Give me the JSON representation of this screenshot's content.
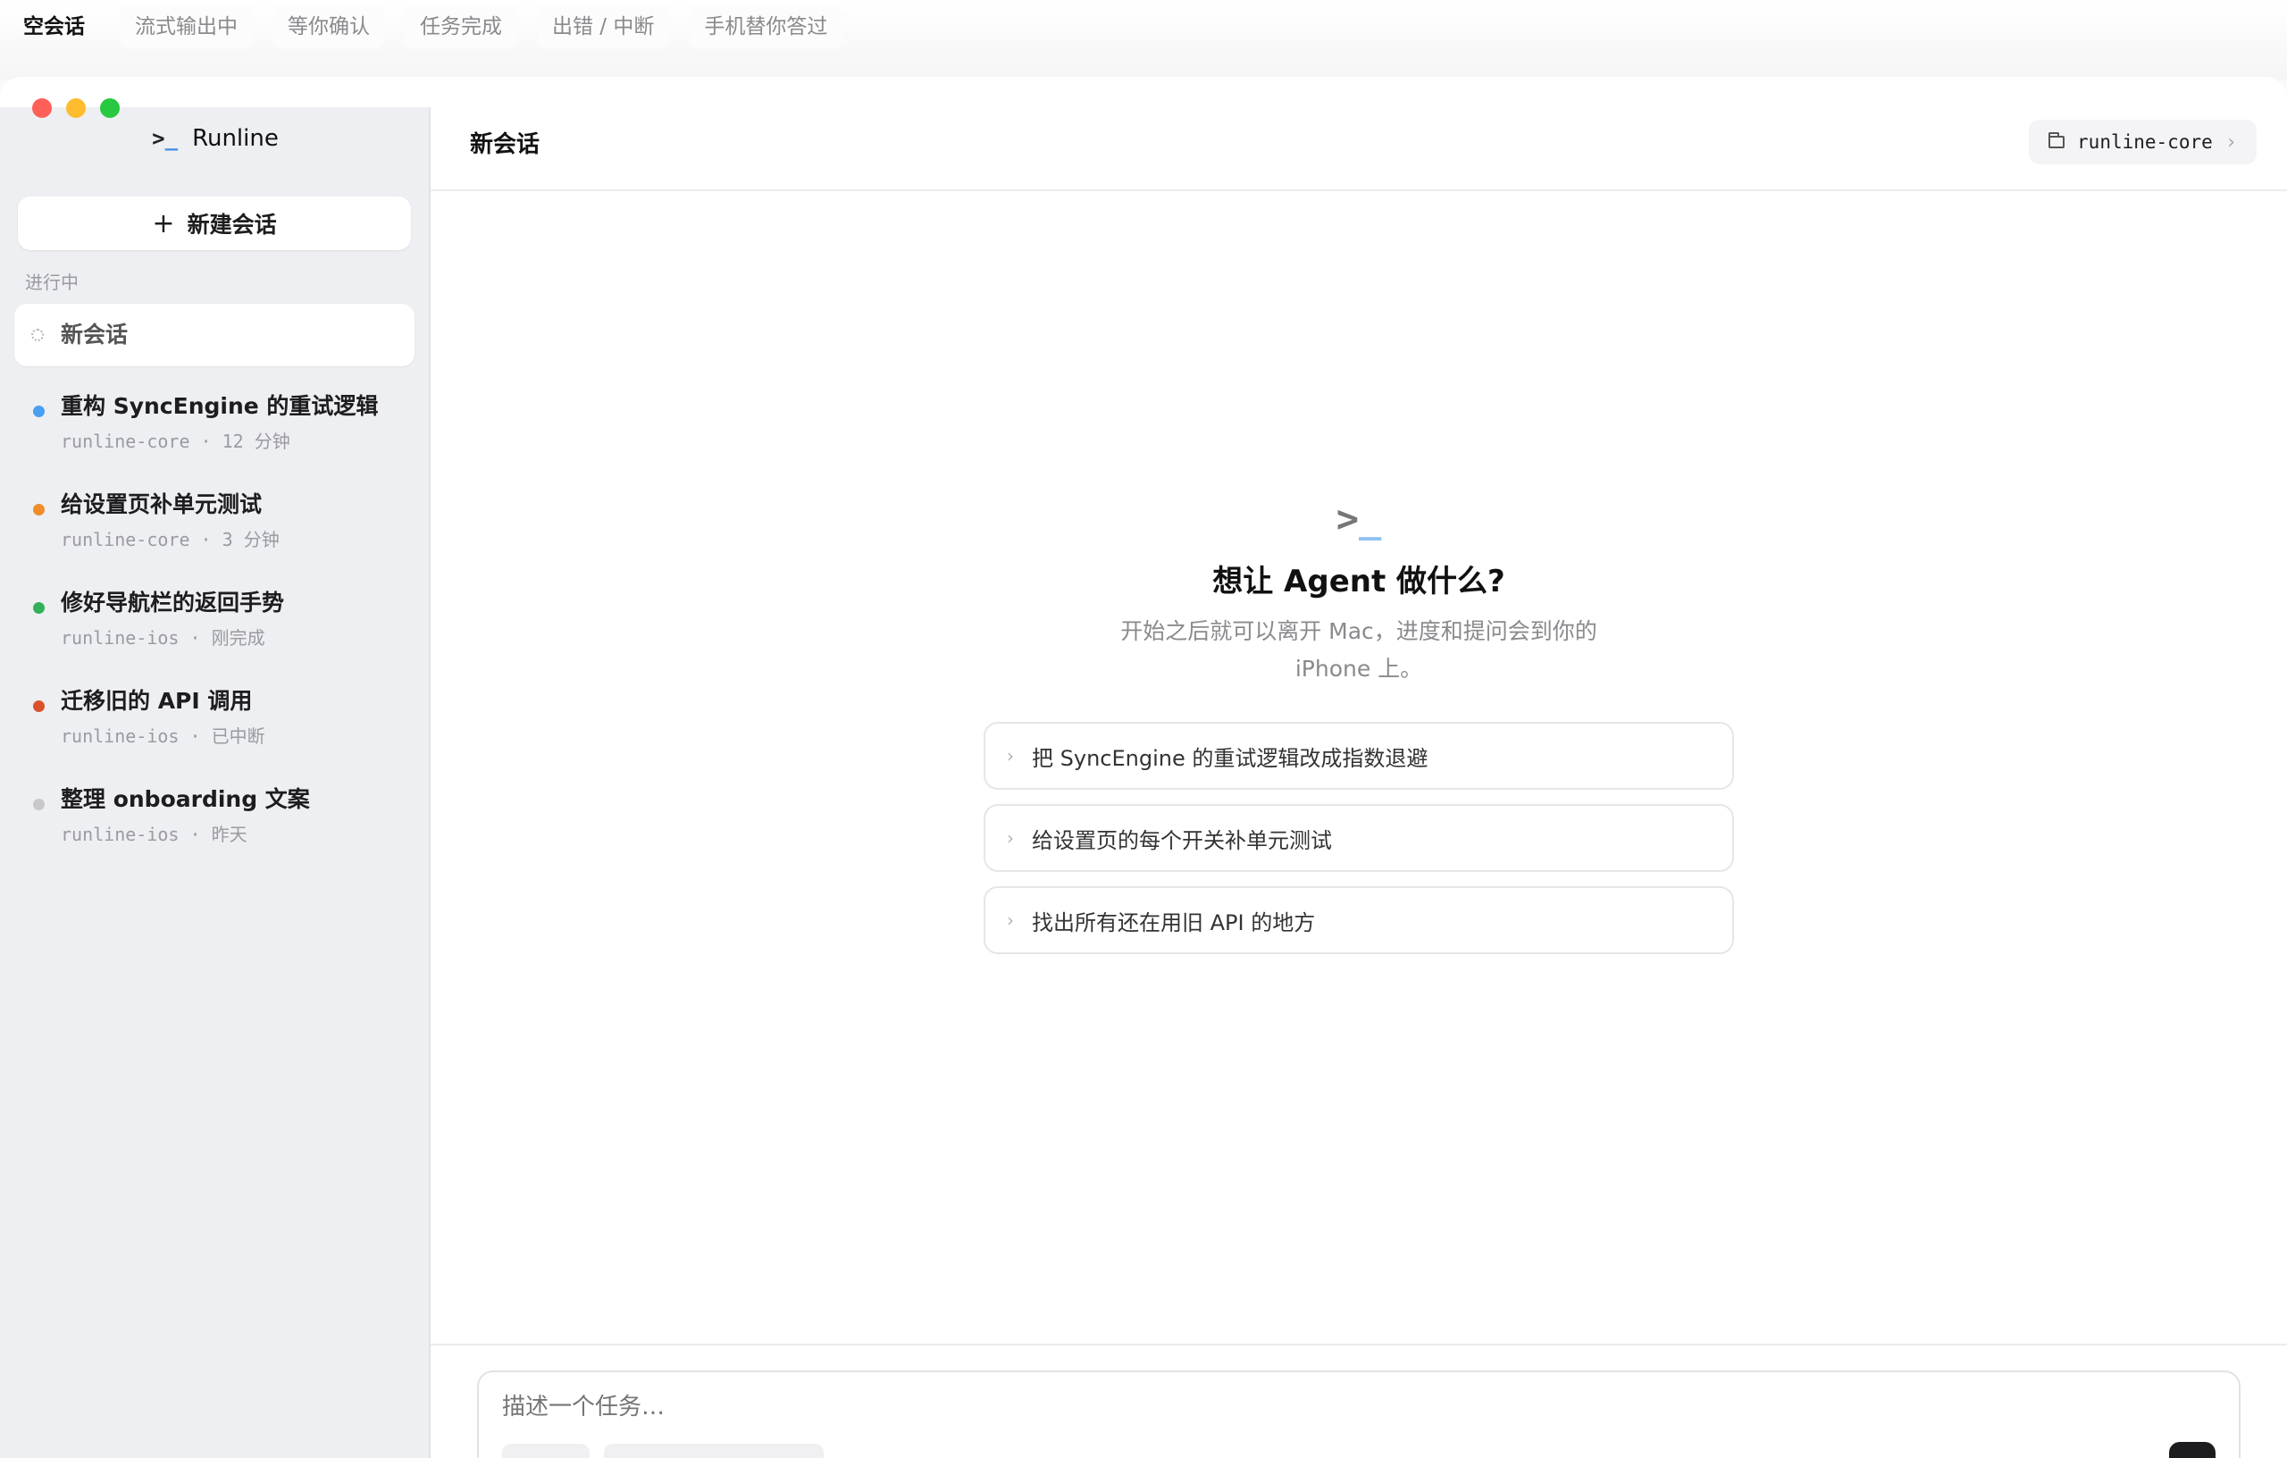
{
  "state_tabs": [
    "空会话",
    "流式输出中",
    "等你确认",
    "任务完成",
    "出错 / 中断",
    "手机替你答过"
  ],
  "brand": {
    "mark": ">",
    "name": "Runline"
  },
  "sidebar": {
    "new_button": "新建会话",
    "section_label": "进行中",
    "active_session": "新会话",
    "sessions": [
      {
        "title": "重构 SyncEngine 的重试逻辑",
        "meta": "runline-core · 12 分钟",
        "color": "#4a9ff0"
      },
      {
        "title": "给设置页补单元测试",
        "meta": "runline-core · 3 分钟",
        "color": "#f08c2a"
      },
      {
        "title": "修好导航栏的返回手势",
        "meta": "runline-ios · 刚完成",
        "color": "#34b05a"
      },
      {
        "title": "迁移旧的 API 调用",
        "meta": "runline-ios · 已中断",
        "color": "#d9522b"
      },
      {
        "title": "整理 onboarding 文案",
        "meta": "runline-ios · 昨天",
        "color": "#c8c8cc"
      }
    ]
  },
  "main": {
    "title": "新会话",
    "repo": "runline-core",
    "empty_title": "想让 Agent 做什么?",
    "empty_sub": "开始之后就可以离开 Mac，进度和提问会到你的 iPhone 上。",
    "suggestions": [
      "把 SyncEngine 的重试逻辑改成指数退避",
      "给设置页的每个开关补单元测试",
      "找出所有还在用旧 API 的地方"
    ],
    "composer_placeholder": "描述一个任务…"
  }
}
